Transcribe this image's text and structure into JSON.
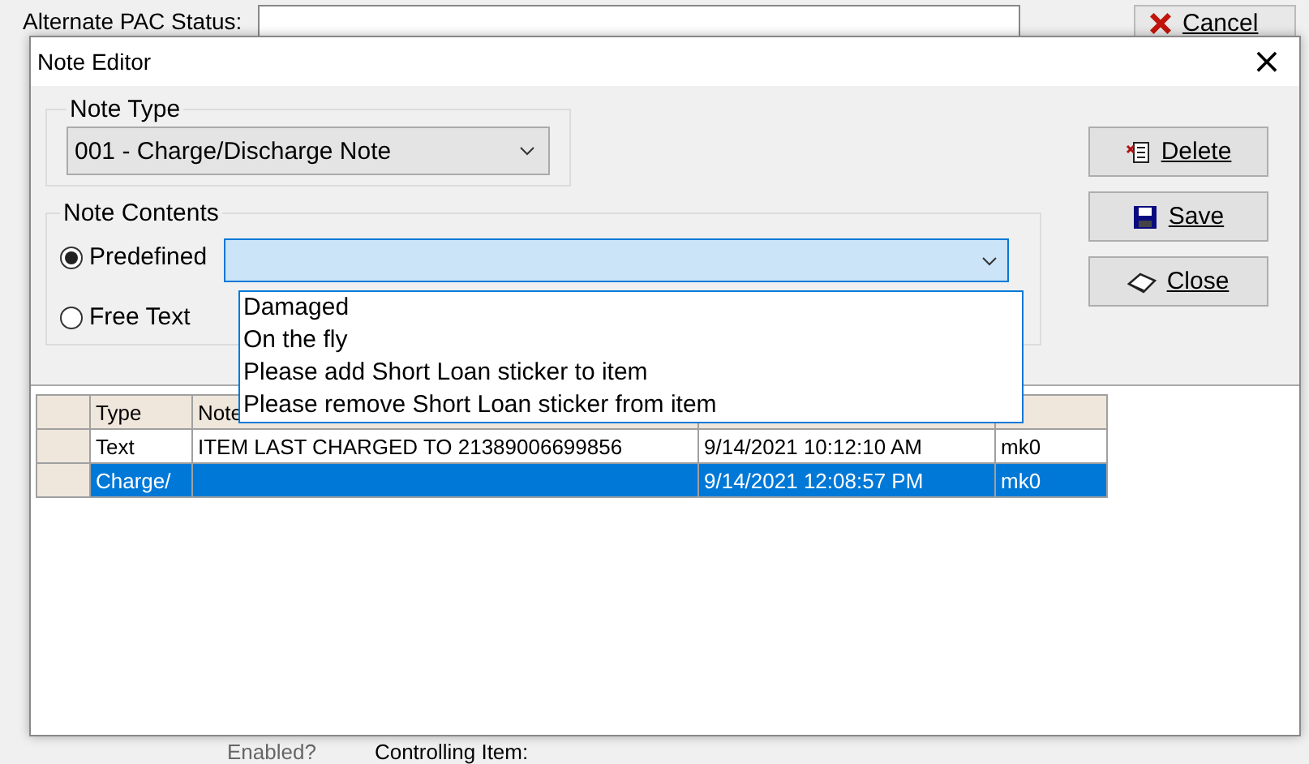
{
  "background": {
    "status_label": "Alternate PAC Status:",
    "cancel_button": "Cancel",
    "enabled_label": "Enabled?",
    "controlling_label": "Controlling Item:"
  },
  "window": {
    "title": "Note Editor",
    "close": "×"
  },
  "note_type": {
    "legend": "Note Type",
    "value": "001 - Charge/Discharge Note"
  },
  "note_contents": {
    "legend": "Note Contents",
    "options": [
      {
        "label": "Predefined",
        "selected": true
      },
      {
        "label": "Free Text",
        "selected": false
      }
    ],
    "dropdown_items": [
      "Damaged",
      "On the fly",
      "Please add Short Loan sticker to item",
      "Please remove Short Loan sticker from item"
    ]
  },
  "buttons": [
    {
      "kind": "delete",
      "label": "Delete"
    },
    {
      "kind": "save",
      "label": "Save"
    },
    {
      "kind": "close",
      "label": "Close"
    }
  ],
  "table": {
    "columns": [
      "Type",
      "Note"
    ],
    "rows": [
      {
        "cells": [
          "Text",
          "ITEM LAST CHARGED TO 21389006699856",
          "9/14/2021 10:12:10 AM",
          "mk0"
        ],
        "selected": false
      },
      {
        "cells": [
          "Charge/",
          "",
          "9/14/2021 12:08:57 PM",
          "mk0"
        ],
        "selected": true
      }
    ]
  }
}
